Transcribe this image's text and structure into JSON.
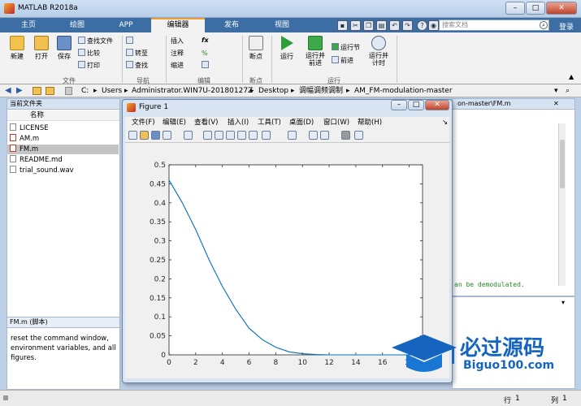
{
  "window": {
    "title": "MATLAB R2018a"
  },
  "tabs": [
    "主页",
    "绘图",
    "APP",
    "编辑器",
    "发布",
    "视图"
  ],
  "search": {
    "placeholder": "搜索文档"
  },
  "signin": "登录",
  "ribbon": {
    "file": {
      "new": "新建",
      "open": "打开",
      "save": "保存",
      "find_file": "查找文件",
      "compare": "比较",
      "print": "打印",
      "group": "文件"
    },
    "nav": {
      "goto": "转至",
      "find": "查找",
      "group": "导航"
    },
    "edit": {
      "insert": "插入",
      "comment": "注释",
      "indent": "缩进",
      "group": "编辑"
    },
    "breakpoint": {
      "label": "断点",
      "group": "断点"
    },
    "run": {
      "run": "运行",
      "run_advance": "运行并\n前进",
      "run_section": "运行节",
      "advance": "前进",
      "run_time": "运行并\n计时",
      "group": "运行"
    }
  },
  "address": {
    "parts": [
      "C:",
      "Users",
      "Administrator.WIN7U-20180127Z",
      "Desktop",
      "调幅调频调制",
      "AM_FM-modulation-master"
    ]
  },
  "current_folder": {
    "title": "当前文件夹",
    "name_col": "名称",
    "files": [
      {
        "name": "LICENSE",
        "selected": false
      },
      {
        "name": "AM.m",
        "selected": false
      },
      {
        "name": "FM.m",
        "selected": true
      },
      {
        "name": "README.md",
        "selected": false
      },
      {
        "name": "trial_sound.wav",
        "selected": false
      }
    ]
  },
  "details": {
    "title": "FM.m  (脚本)",
    "text": "reset the command window, environment variables, and all figures."
  },
  "editor": {
    "tab": "on-master\\FM.m",
    "snippet": "an be demodulated."
  },
  "figure": {
    "title": "Figure 1",
    "menus": [
      "文件(F)",
      "编辑(E)",
      "查看(V)",
      "插入(I)",
      "工具(T)",
      "桌面(D)",
      "窗口(W)",
      "帮助(H)"
    ]
  },
  "chart_data": {
    "type": "line",
    "title": "",
    "xlabel": "",
    "ylabel": "",
    "xlim": [
      0,
      19
    ],
    "ylim": [
      0,
      0.5
    ],
    "xticks": [
      0,
      2,
      4,
      6,
      8,
      10,
      12,
      14,
      16,
      18
    ],
    "yticks": [
      0,
      0.05,
      0.1,
      0.15,
      0.2,
      0.25,
      0.3,
      0.35,
      0.4,
      0.45,
      0.5
    ],
    "series": [
      {
        "color": "#0072bd",
        "x": [
          0,
          1,
          2,
          3,
          4,
          5,
          6,
          7,
          8,
          9,
          10,
          11,
          12,
          13,
          14,
          15,
          16,
          17,
          18,
          19
        ],
        "y": [
          0.46,
          0.4,
          0.33,
          0.25,
          0.18,
          0.12,
          0.07,
          0.04,
          0.02,
          0.008,
          0.003,
          0.001,
          0,
          0,
          0,
          0,
          0,
          0,
          0,
          0
        ]
      }
    ]
  },
  "status": {
    "row_label": "行",
    "row": "1",
    "col_label": "列",
    "col": "1"
  },
  "watermark": {
    "text": "必过源码",
    "sub": "Biguo100.com"
  }
}
